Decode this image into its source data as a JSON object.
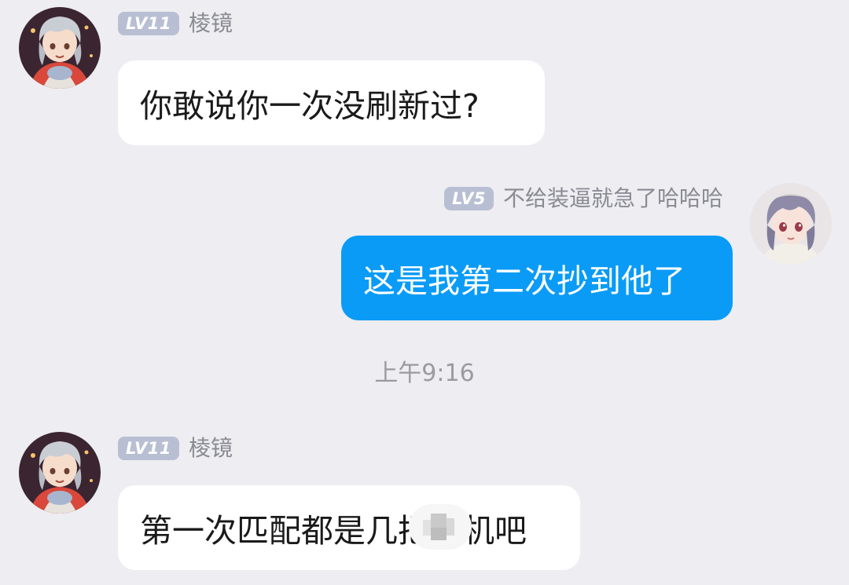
{
  "messages": [
    {
      "level": "LV11",
      "name": "棱镜",
      "text": "你敢说你一次没刷新过?"
    },
    {
      "level": "LV5",
      "name": "不给装逼就急了哈哈哈",
      "text": "这是我第二次抄到他了"
    },
    {
      "level": "LV11",
      "name": "棱镜",
      "text": "第一次匹配都是几把人机吧"
    }
  ],
  "timestamp": "上午9:16",
  "colors": {
    "background": "#ededf2",
    "incoming_bubble": "#ffffff",
    "outgoing_bubble": "#0a9bf6",
    "level_badge": "#b9bfd3",
    "name_text": "#8a8a93"
  },
  "icons": {
    "avatar_left": "anime-girl-silver-hair-avatar",
    "avatar_right": "anime-girl-purple-hair-avatar",
    "redaction": "mosaic-redaction"
  }
}
